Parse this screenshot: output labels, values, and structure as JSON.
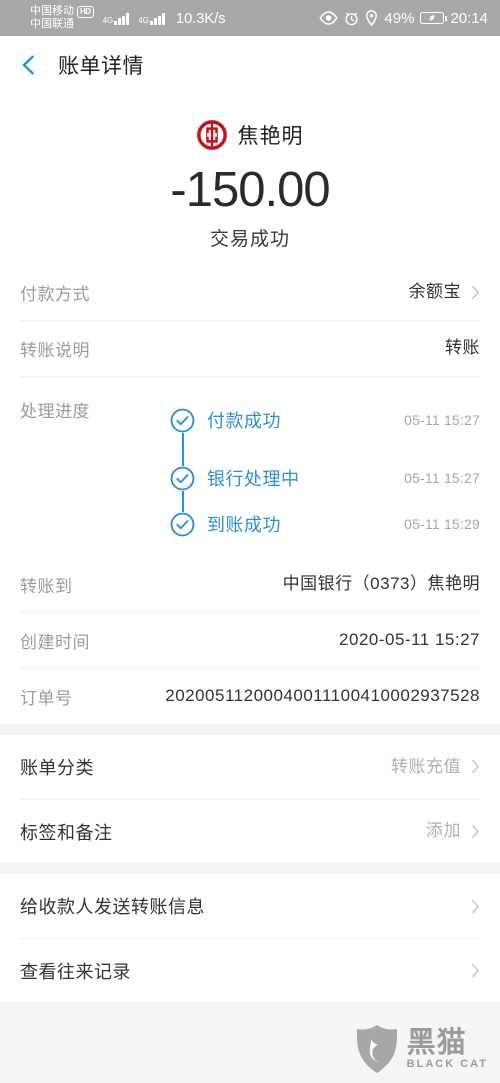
{
  "status_bar": {
    "carrier_primary": "中国移动",
    "carrier_hd_badge": "HD",
    "carrier_secondary": "中国联通",
    "network_gen_1": "4G",
    "network_gen_2": "4G",
    "network_speed": "10.3K/s",
    "battery_percent": "49%",
    "clock": "20:14",
    "icons": [
      "eye-icon",
      "alarm-clock-icon",
      "location-pin-icon",
      "battery-charging-icon"
    ]
  },
  "header": {
    "back_icon": "chevron-left-icon",
    "title": "账单详情"
  },
  "summary": {
    "bank_logo": "bank-of-china-logo",
    "payee_name": "焦艳明",
    "amount": "-150.00",
    "status": "交易成功"
  },
  "details": {
    "payment_method": {
      "label": "付款方式",
      "value": "余额宝",
      "chevron": "chevron-right-icon"
    },
    "transfer_note": {
      "label": "转账说明",
      "value": "转账"
    },
    "progress": {
      "label": "处理进度",
      "steps": [
        {
          "text": "付款成功",
          "time": "05-11 15:27",
          "icon": "check-circle-icon"
        },
        {
          "text": "银行处理中",
          "time": "05-11 15:27",
          "icon": "check-circle-icon"
        },
        {
          "text": "到账成功",
          "time": "05-11 15:29",
          "icon": "check-circle-icon"
        }
      ]
    },
    "transfer_to": {
      "label": "转账到",
      "value": "中国银行（0373）焦艳明"
    },
    "create_time": {
      "label": "创建时间",
      "value": "2020-05-11 15:27"
    },
    "order_no": {
      "label": "订单号",
      "value": "20200511200040011100410002937528"
    }
  },
  "category_section": {
    "bill_category": {
      "label": "账单分类",
      "value": "转账充值",
      "chevron": "chevron-right-icon"
    },
    "tags_and_notes": {
      "label": "标签和备注",
      "value": "添加",
      "chevron": "chevron-right-icon"
    }
  },
  "actions_section": {
    "send_info": {
      "label": "给收款人发送转账信息",
      "chevron": "chevron-right-icon"
    },
    "view_records": {
      "label": "查看往来记录",
      "chevron": "chevron-right-icon"
    }
  },
  "watermark": {
    "logo": "black-cat-shield-logo",
    "cn": "黑猫",
    "en": "BLACK CAT"
  },
  "colors": {
    "accent_blue": "#2d8fd5",
    "bank_red": "#c0151b",
    "status_bar_bg": "#a8a8a8",
    "label_gray": "#9b9b9b",
    "section_gap": "#f4f4f4"
  }
}
